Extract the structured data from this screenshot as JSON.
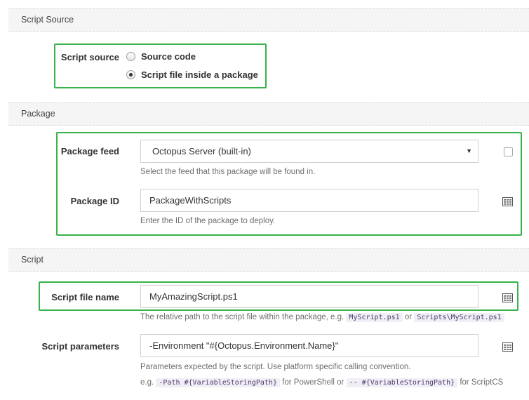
{
  "sections": {
    "script_source": "Script Source",
    "package": "Package",
    "script": "Script"
  },
  "script_source": {
    "label": "Script source",
    "options": [
      {
        "label": "Source code",
        "selected": false
      },
      {
        "label": "Script file inside a package",
        "selected": true
      }
    ]
  },
  "package": {
    "feed_label": "Package feed",
    "feed_value": "Octopus Server (built-in)",
    "feed_help": "Select the feed that this package will be found in.",
    "id_label": "Package ID",
    "id_value": "PackageWithScripts",
    "id_help": "Enter the ID of the package to deploy."
  },
  "script": {
    "file_label": "Script file name",
    "file_value": "MyAmazingScript.ps1",
    "file_help_prefix": "The relative path to the script file within the package, e.g.",
    "file_help_code1": "MyScript.ps1",
    "file_help_or": "or",
    "file_help_code2": "Scripts\\MyScript.ps1",
    "params_label": "Script parameters",
    "params_value": "-Environment \"#{Octopus.Environment.Name}\"",
    "params_help1": "Parameters expected by the script. Use platform specific calling convention.",
    "params_help2_prefix": "e.g.",
    "params_help2_code1": "-Path #{VariableStoringPath}",
    "params_help2_mid": "for PowerShell or",
    "params_help2_code2": "-- #{VariableStoringPath}",
    "params_help2_suffix": "for ScriptCS"
  },
  "icons": {
    "variable": "variable-binding-icon",
    "dropdown": "chevron-down-icon"
  },
  "colors": {
    "highlight": "#37b34a"
  }
}
